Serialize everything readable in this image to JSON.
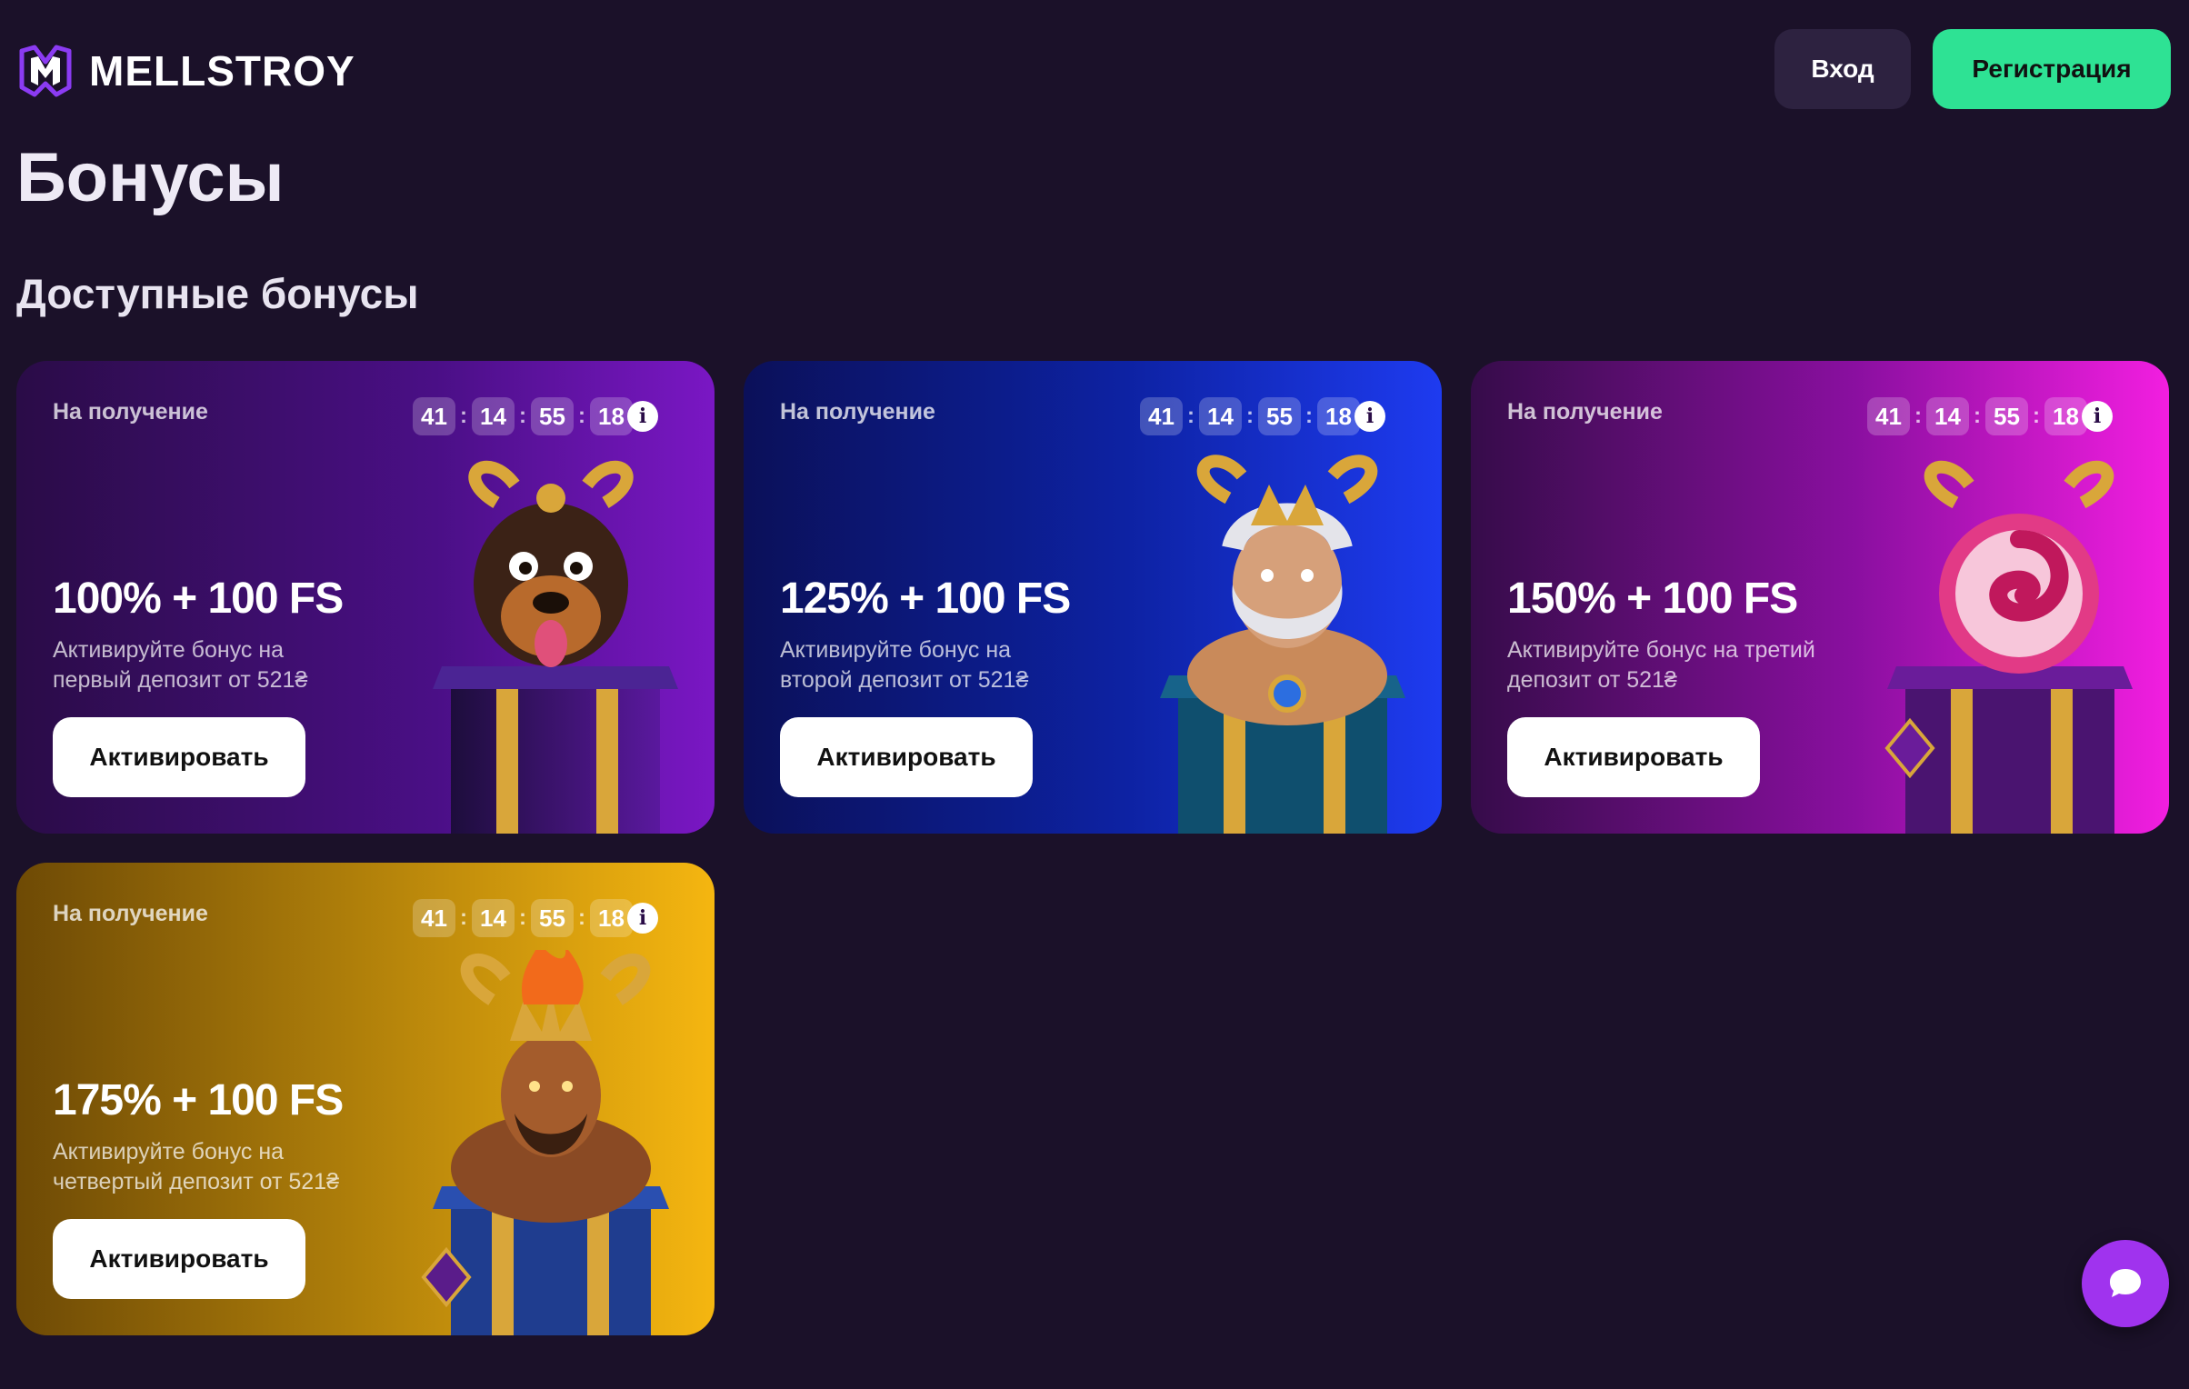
{
  "header": {
    "logo_text": "MELLSTROY",
    "login_label": "Вход",
    "register_label": "Регистрация"
  },
  "page": {
    "title": "Бонусы",
    "section_title": "Доступные бонусы"
  },
  "cards": [
    {
      "label": "На получение",
      "timer": [
        "41",
        "14",
        "55",
        "18"
      ],
      "title": "100% + 100 FS",
      "description": "Активируйте бонус на первый депозит от 521₴",
      "button": "Активировать",
      "art_icon": "dog-in-gift-box-icon",
      "accent": "#7a17c4"
    },
    {
      "label": "На получение",
      "timer": [
        "41",
        "14",
        "55",
        "18"
      ],
      "title": "125% + 100 FS",
      "description": "Активируйте бонус на второй депозит от 521₴",
      "button": "Активировать",
      "art_icon": "zeus-in-gift-box-icon",
      "accent": "#1e3bf0"
    },
    {
      "label": "На получение",
      "timer": [
        "41",
        "14",
        "55",
        "18"
      ],
      "title": "150% + 100 FS",
      "description": "Активируйте бонус на третий депозит от 521₴",
      "button": "Активировать",
      "art_icon": "candy-in-gift-box-icon",
      "accent": "#f21ee0"
    },
    {
      "label": "На получение",
      "timer": [
        "41",
        "14",
        "55",
        "18"
      ],
      "title": "175% + 100 FS",
      "description": "Активируйте бонус на четвертый депозит от 521₴",
      "button": "Активировать",
      "art_icon": "fire-king-in-gift-box-icon",
      "accent": "#f5b610"
    }
  ],
  "colors": {
    "background": "#1b1129",
    "register_button": "#2ee294",
    "login_button": "#2d2240",
    "chat_button": "#a033ee"
  }
}
